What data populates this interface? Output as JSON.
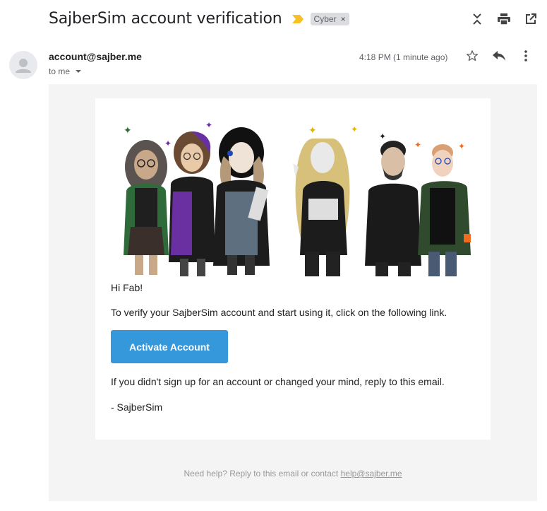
{
  "header": {
    "subject": "SajberSim account verification",
    "label": "Cyber",
    "label_remove": "×"
  },
  "message": {
    "sender": "account@sajber.me",
    "to": "to me",
    "time": "4:18 PM (1 minute ago)"
  },
  "body": {
    "greeting": "Hi Fab!",
    "paragraph1": "To verify your SajberSim account and start using it, click on the following link.",
    "button_label": "Activate Account",
    "paragraph2": "If you didn't sign up for an account or changed your mind, reply to this email.",
    "signature": "- SajberSim"
  },
  "footer": {
    "text": "Need help? Reply to this email or contact ",
    "link": "help@sajber.me"
  },
  "colors": {
    "button": "#3498db",
    "background": "#f4f4f4",
    "importance": "#f6c026"
  },
  "icons": [
    "importance-marker-icon",
    "collapse-all-icon",
    "print-icon",
    "open-in-new-window-icon",
    "star-icon",
    "reply-icon",
    "more-options-icon",
    "person-avatar-icon"
  ]
}
